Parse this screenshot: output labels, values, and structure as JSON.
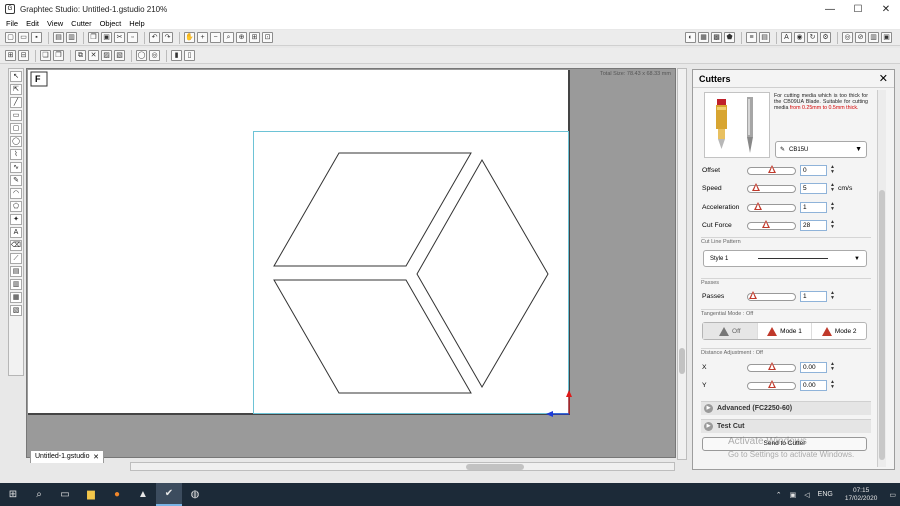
{
  "window": {
    "title": "Graphtec Studio: Untitled-1.gstudio 210%",
    "minimize": "—",
    "maximize": "☐",
    "close": "✕"
  },
  "menu": [
    "File",
    "Edit",
    "View",
    "Cutter",
    "Object",
    "Help"
  ],
  "canvas": {
    "size_info": "Total Size: 78.43 x 68.33 mm",
    "tab_label": "Untitled-1.gstudio",
    "tab_close": "✕"
  },
  "cutters_panel": {
    "title": "Cutters",
    "close": "✕",
    "blade_desc_black": "For cutting media which is too thick for the CB09UA Blade. Suitable for cutting media",
    "blade_desc_red": "from 0.25mm to 0.5mm thick.",
    "blade_name": "CB15U",
    "offset": {
      "label": "Offset",
      "value": "0",
      "level": 0.5
    },
    "speed": {
      "label": "Speed",
      "value": "5",
      "unit": "cm/s",
      "level": 0.1
    },
    "acceleration": {
      "label": "Acceleration",
      "value": "1",
      "level": 0.15
    },
    "cut_force": {
      "label": "Cut Force",
      "value": "28",
      "level": 0.35
    },
    "cut_line_pattern": {
      "label": "Cut Line Pattern",
      "value": "Style 1"
    },
    "passes": {
      "label": "Passes",
      "section": "Passes",
      "value": "1",
      "level": 0.02
    },
    "tangential": {
      "label": "Tangential Mode : Off",
      "modes": [
        "Off",
        "Mode 1",
        "Mode 2"
      ]
    },
    "distance": {
      "label": "Distance Adjustment : Off",
      "x_label": "X",
      "x_value": "0.00",
      "x_level": 0.5,
      "y_label": "Y",
      "y_value": "0.00",
      "y_level": 0.5
    },
    "advanced_label": "Advanced (FC2250-60)",
    "test_cut_label": "Test Cut",
    "send_label": "Send to Cutter",
    "watermark_line1": "Activate Windows",
    "watermark_line2": "Go to Settings to activate Windows."
  },
  "taskbar": {
    "language": "ENG",
    "time": "07:15",
    "date": "17/02/2020"
  }
}
